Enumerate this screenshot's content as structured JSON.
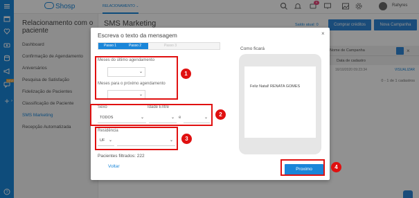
{
  "app": {
    "logo": "Shosp",
    "active_tab": "RELACIONAMENTO",
    "user_name": "Rahyres",
    "notification_count": "9"
  },
  "sidebar": {
    "title": "Relacionamento com o paciente",
    "items": [
      {
        "label": "Dashboard"
      },
      {
        "label": "Confirmação de Agendamento"
      },
      {
        "label": "Aniversários"
      },
      {
        "label": "Pesquisa de Satisfação"
      },
      {
        "label": "Fidelização de Pacientes"
      },
      {
        "label": "Classificação de Paciente"
      },
      {
        "label": "SMS Marketing",
        "active": true
      },
      {
        "label": "Recepção Automatizada"
      }
    ]
  },
  "page": {
    "title": "SMS Marketing",
    "saldo": "Saldo atual: 0",
    "buy_button": "Comprar créditos",
    "new_button": "Nova Campanha",
    "table": {
      "col_name": "Nome de Campanha",
      "col_date": "Data de cadastro",
      "rows": [
        {
          "date": "16/10/2020 09:23:34",
          "action": "VISUALIZAR"
        }
      ],
      "count": "0 - 1 de 1 cadastros"
    }
  },
  "modal": {
    "title": "Escreva o texto da mensagem",
    "close": "×",
    "steps": [
      "Passo 1",
      "Passo 2",
      "Passo 3"
    ],
    "meses_ultimo_label": "Meses do último agendamento",
    "meses_proximo_label": "Meses para o próximo agendamento",
    "sexo_label": "Sexo",
    "sexo_value": "TODOS",
    "idade_label": "Idade Entre",
    "idade_sep": "e",
    "residencia_label": "Residência",
    "uf_value": "UF",
    "filtered": "Pacientes filtrados: 222",
    "voltar": "Voltar",
    "preview_label": "Como ficará",
    "preview_message": "Feliz Natal! RENATA GOMES",
    "proximo": "Proximo"
  },
  "callouts": [
    "1",
    "2",
    "3",
    "4"
  ],
  "colors": {
    "brand": "#1a86d9",
    "highlight": "#e01010"
  }
}
